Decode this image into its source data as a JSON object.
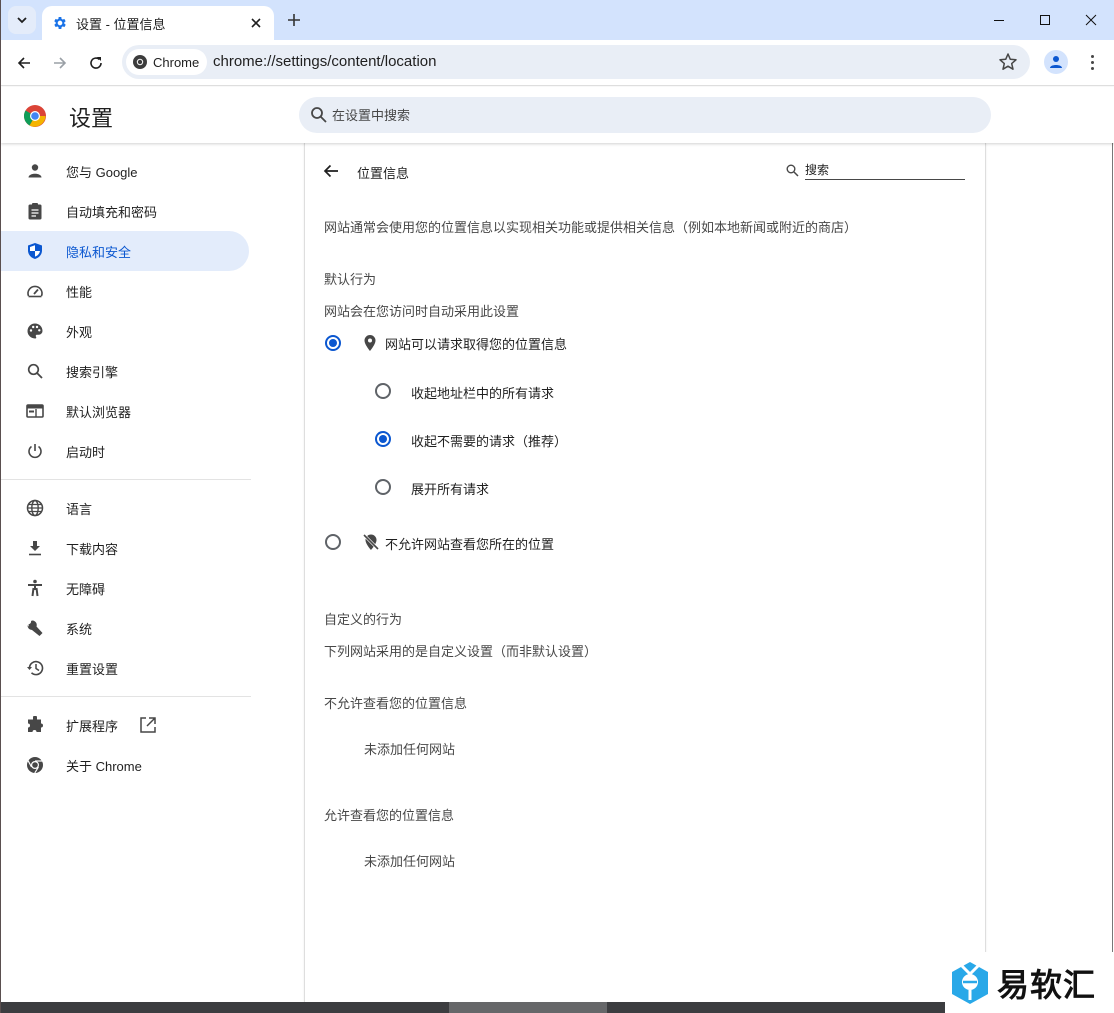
{
  "browser": {
    "tab_title": "设置 - 位置信息",
    "new_tab_label": "+",
    "chip_label": "Chrome",
    "url": "chrome://settings/content/location"
  },
  "settings": {
    "title": "设置",
    "search_placeholder": "在设置中搜索"
  },
  "sidebar": {
    "items": [
      {
        "label": "您与 Google",
        "icon": "person-icon"
      },
      {
        "label": "自动填充和密码",
        "icon": "clipboard-icon"
      },
      {
        "label": "隐私和安全",
        "icon": "shield-icon",
        "active": true
      },
      {
        "label": "性能",
        "icon": "gauge-icon"
      },
      {
        "label": "外观",
        "icon": "palette-icon"
      },
      {
        "label": "搜索引擎",
        "icon": "search-icon"
      },
      {
        "label": "默认浏览器",
        "icon": "browser-window-icon"
      },
      {
        "label": "启动时",
        "icon": "power-icon"
      },
      {
        "label": "语言",
        "icon": "globe-icon"
      },
      {
        "label": "下载内容",
        "icon": "download-icon"
      },
      {
        "label": "无障碍",
        "icon": "accessibility-icon"
      },
      {
        "label": "系统",
        "icon": "wrench-icon"
      },
      {
        "label": "重置设置",
        "icon": "history-icon"
      },
      {
        "label": "扩展程序",
        "icon": "puzzle-icon"
      },
      {
        "label": "关于 Chrome",
        "icon": "chrome-icon"
      }
    ]
  },
  "page": {
    "title": "位置信息",
    "search_placeholder": "搜索",
    "description": "网站通常会使用您的位置信息以实现相关功能或提供相关信息（例如本地新闻或附近的商店）",
    "default_section": {
      "heading": "默认行为",
      "subheading": "网站会在您访问时自动采用此设置",
      "options": [
        {
          "label": "网站可以请求取得您的位置信息",
          "selected": true
        },
        {
          "label": "不允许网站查看您所在的位置",
          "selected": false
        }
      ],
      "sub_options": [
        {
          "label": "收起地址栏中的所有请求",
          "selected": false
        },
        {
          "label": "收起不需要的请求（推荐）",
          "selected": true
        },
        {
          "label": "展开所有请求",
          "selected": false
        }
      ]
    },
    "custom_section": {
      "heading": "自定义的行为",
      "subheading": "下列网站采用的是自定义设置（而非默认设置）",
      "blocked_heading": "不允许查看您的位置信息",
      "blocked_empty": "未添加任何网站",
      "allowed_heading": "允许查看您的位置信息",
      "allowed_empty": "未添加任何网站"
    }
  },
  "watermark": {
    "text": "易软汇"
  },
  "colors": {
    "accent": "#0b57d0",
    "active_nav_bg": "#e3ecfb",
    "tabstrip_bg": "#d3e3fd",
    "omnibox_bg": "#e9eef6"
  }
}
